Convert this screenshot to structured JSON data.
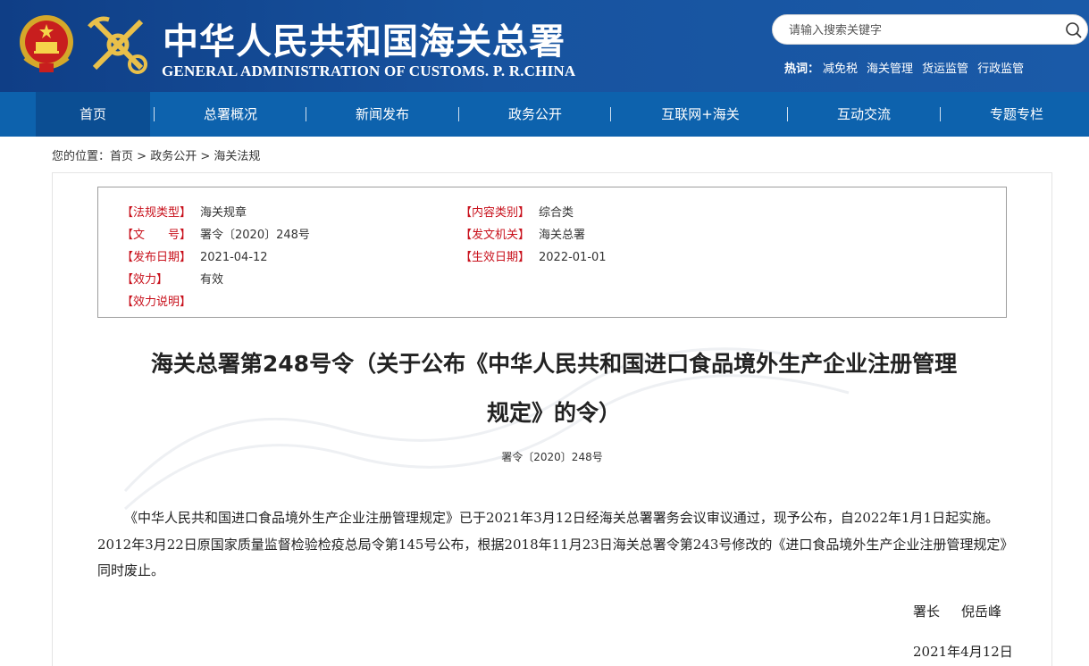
{
  "header": {
    "title_cn": "中华人民共和国海关总署",
    "title_en": "GENERAL ADMINISTRATION OF CUSTOMS. P. R.CHINA",
    "search_placeholder": "请输入搜索关键字",
    "hot_label": "热词：",
    "hot_words": [
      "减免税",
      "海关管理",
      "货运监管",
      "行政监管"
    ]
  },
  "nav": {
    "items": [
      "首页",
      "总署概况",
      "新闻发布",
      "政务公开",
      "互联网+海关",
      "互动交流",
      "专题专栏"
    ],
    "active_index": 0,
    "separator": "|"
  },
  "breadcrumb": {
    "prefix": "您的位置：",
    "items": [
      "首页",
      "政务公开",
      "海关法规"
    ],
    "separator": ">"
  },
  "meta": {
    "fields": [
      {
        "label": "【法规类型】",
        "value": "海关规章"
      },
      {
        "label": "【内容类别】",
        "value": "综合类"
      },
      {
        "label": "【文　　号】",
        "value": "署令〔2020〕248号"
      },
      {
        "label": "【发文机关】",
        "value": "海关总署"
      },
      {
        "label": "【发布日期】",
        "value": "2021-04-12"
      },
      {
        "label": "【生效日期】",
        "value": "2022-01-01"
      },
      {
        "label": "【效力】",
        "value": "有效"
      },
      {
        "label": "【效力说明】",
        "value": ""
      }
    ]
  },
  "article": {
    "title_line1": "海关总署第248号令（关于公布《中华人民共和国进口食品境外生产企业注册管理",
    "title_line2": "规定》的令）",
    "doc_number": "署令〔2020〕248号",
    "body": "《中华人民共和国进口食品境外生产企业注册管理规定》已于2021年3月12日经海关总署署务会议审议通过，现予公布，自2022年1月1日起实施。2012年3月22日原国家质量监督检验检疫总局令第145号公布，根据2018年11月23日海关总署令第243号修改的《进口食品境外生产企业注册管理规定》同时废止。",
    "signer_role": "署长",
    "signer_name": "倪岳峰",
    "date": "2021年4月12日"
  },
  "colors": {
    "header_bg": "#17539f",
    "nav_bg": "#0d62ad",
    "nav_active": "#0b4e93",
    "meta_label": "#c8101b"
  },
  "icons": [
    "national-emblem-icon",
    "customs-emblem-icon",
    "search-icon"
  ]
}
